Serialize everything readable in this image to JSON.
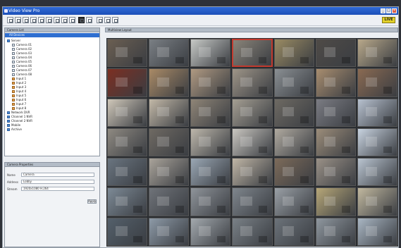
{
  "window": {
    "title": "Video View Pro"
  },
  "toolbar": {
    "buttons": [
      "new",
      "open",
      "save",
      "camera",
      "layout-1",
      "layout-4",
      "layout-9",
      "layout-16",
      "record",
      "snapshot",
      "settings",
      "help",
      "info",
      "exit"
    ],
    "badge": "LIVE"
  },
  "left_panel": {
    "title": "Camera List",
    "selected_item": "All Devices",
    "tree": [
      {
        "label": "Server",
        "kind": "grp"
      },
      {
        "label": "Camera 01",
        "kind": "dev"
      },
      {
        "label": "Camera 02",
        "kind": "dev"
      },
      {
        "label": "Camera 03",
        "kind": "dev"
      },
      {
        "label": "Camera 04",
        "kind": "dev"
      },
      {
        "label": "Camera 05",
        "kind": "dev"
      },
      {
        "label": "Camera 06",
        "kind": "dev"
      },
      {
        "label": "Camera 07",
        "kind": "dev"
      },
      {
        "label": "Camera 08",
        "kind": "dev"
      },
      {
        "label": "Input 1",
        "kind": "cam"
      },
      {
        "label": "Input 2",
        "kind": "cam"
      },
      {
        "label": "Input 3",
        "kind": "cam"
      },
      {
        "label": "Input 4",
        "kind": "cam"
      },
      {
        "label": "Input 5",
        "kind": "cam"
      },
      {
        "label": "Input 6",
        "kind": "cam"
      },
      {
        "label": "Input 7",
        "kind": "cam"
      },
      {
        "label": "Input 8",
        "kind": "cam"
      },
      {
        "label": "Network DVR",
        "kind": "grp"
      },
      {
        "label": "Channel 1 NVR",
        "kind": "grp"
      },
      {
        "label": "Channel 2 NVR",
        "kind": "grp"
      },
      {
        "label": "Mobile",
        "kind": "grp"
      },
      {
        "label": "Archive",
        "kind": "grp"
      }
    ]
  },
  "properties": {
    "title": "Camera Properties",
    "fields": [
      {
        "label": "Name",
        "value": "Camera"
      },
      {
        "label": "Address",
        "value": "Lobby"
      },
      {
        "label": "Stream",
        "value": "1920x1080 H.264"
      }
    ],
    "apply_label": "Apply"
  },
  "view": {
    "title": "Multiview Layout",
    "rows": 7,
    "cols": 7,
    "active_cell": 3,
    "cell_colors": [
      "#6b5f52",
      "#7a7f84",
      "#c7c9c6",
      "#8a8479",
      "#9a8b63",
      "#4f4b47",
      "#b8a88a",
      "#7c2f22",
      "#a98a66",
      "#b09a82",
      "#9e9588",
      "#8a8f93",
      "#a88d6f",
      "#8a6a52",
      "#cfc7b9",
      "#c2b8a7",
      "#8f8577",
      "#a59f93",
      "#6e6a63",
      "#7b7c83",
      "#b7c1cf",
      "#8f8a82",
      "#6f6a63",
      "#bdb7ab",
      "#c9c6c0",
      "#b0aaa0",
      "#9c8d7a",
      "#c8d3e0",
      "#6a7580",
      "#a9a39a",
      "#9aa7b4",
      "#c0b6a6",
      "#7d6b5a",
      "#9a9187",
      "#b9c4d0",
      "#7d8a96",
      "#6f7379",
      "#8f949a",
      "#7f868d",
      "#9aa0a6",
      "#b7a778",
      "#c1b89f",
      "#54606b",
      "#8d9aa7",
      "#a3a9ae",
      "#7a8187",
      "#6c737a",
      "#8f979f",
      "#a9b6c3"
    ]
  }
}
